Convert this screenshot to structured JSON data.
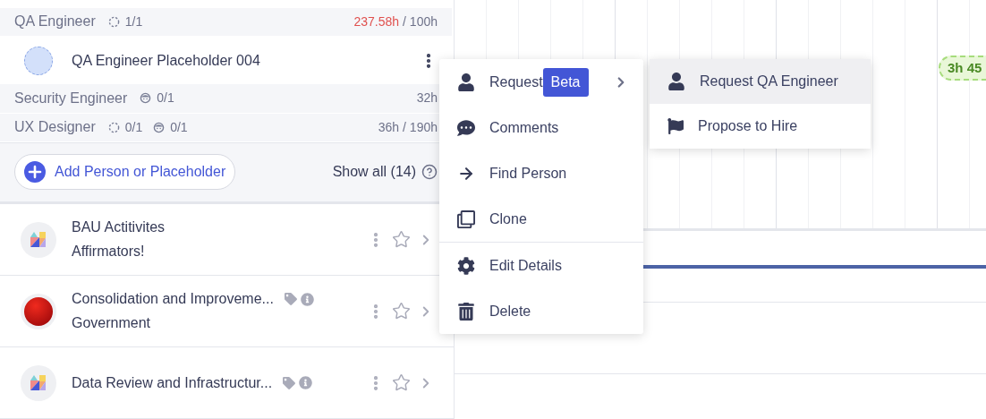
{
  "roles": [
    {
      "name": "QA Engineer",
      "counts": [
        {
          "kind": "placeholder",
          "text": "1/1"
        }
      ],
      "hours": {
        "used": "237.58h",
        "total": "/ 100h",
        "over": true
      }
    },
    {
      "kind": "member",
      "name": "QA Engineer Placeholder 004"
    },
    {
      "name": "Security Engineer",
      "counts": [
        {
          "kind": "person",
          "text": "0/1"
        }
      ],
      "hours": {
        "used": "32h",
        "over": false
      }
    },
    {
      "name": "UX Designer",
      "counts": [
        {
          "kind": "placeholder",
          "text": "0/1"
        },
        {
          "kind": "person",
          "text": "0/1"
        }
      ],
      "hours": {
        "used": "36h",
        "total": "/ 190h",
        "over": false
      }
    }
  ],
  "add_button": "Add Person or Placeholder",
  "show_all": "Show all (14)",
  "projects": [
    {
      "title": "BAU Actitivites",
      "subtitle": "Affirmators!",
      "kind": "logo",
      "tags": false
    },
    {
      "title": "Consolidation and Improveme...",
      "subtitle": "Government",
      "kind": "ball",
      "tags": true
    },
    {
      "title": "Data Review and Infrastructur...",
      "kind": "logo",
      "tags": true
    }
  ],
  "timeline_pill": "3h 45",
  "context_menu": [
    [
      {
        "label": "Request",
        "kind": "user",
        "badge": "Beta",
        "submenu": true
      },
      {
        "label": "Comments",
        "kind": "comment"
      },
      {
        "label": "Find Person",
        "kind": "arrow"
      },
      {
        "label": "Clone",
        "kind": "clone"
      }
    ],
    [
      {
        "label": "Edit Details",
        "kind": "gear"
      },
      {
        "label": "Delete",
        "kind": "trash"
      }
    ]
  ],
  "submenu": [
    {
      "label": "Request QA Engineer",
      "kind": "user",
      "selected": true
    },
    {
      "label": "Propose to Hire",
      "kind": "flag",
      "selected": false
    }
  ]
}
